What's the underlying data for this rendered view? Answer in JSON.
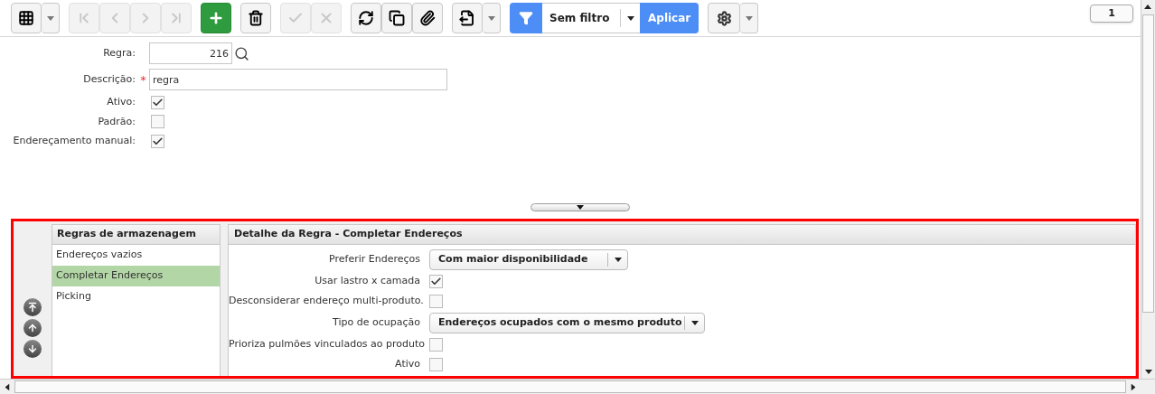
{
  "toolbar": {
    "buttons": [
      {
        "kind": "grid",
        "disabled": false
      },
      {
        "kind": "dropdown",
        "disabled": false
      },
      {
        "kind": "first",
        "disabled": true
      },
      {
        "kind": "previous",
        "disabled": true
      },
      {
        "kind": "next",
        "disabled": true
      },
      {
        "kind": "last",
        "disabled": true
      },
      {
        "kind": "add",
        "disabled": false
      },
      {
        "kind": "delete",
        "disabled": false
      },
      {
        "kind": "confirm",
        "disabled": true
      },
      {
        "kind": "cancel",
        "disabled": true
      },
      {
        "kind": "refresh",
        "disabled": false
      },
      {
        "kind": "copy",
        "disabled": false
      },
      {
        "kind": "attach",
        "disabled": false
      },
      {
        "kind": "export",
        "disabled": false
      },
      {
        "kind": "dropdown",
        "disabled": false
      }
    ],
    "filter": {
      "value": "Sem filtro",
      "apply_button": "Aplicar"
    },
    "page_badge": "1"
  },
  "form": {
    "fields": [
      {
        "kind": "number",
        "label": "Regra:",
        "value": "216"
      },
      {
        "kind": "text",
        "label": "Descrição:",
        "value": "regra",
        "required_mark": "*"
      },
      {
        "kind": "checkbox",
        "label": "Ativo:",
        "checked": true
      },
      {
        "kind": "checkbox",
        "label": "Padrão:",
        "checked": false
      },
      {
        "kind": "checkbox",
        "label": "Endereçamento manual:",
        "checked": true
      }
    ]
  },
  "rules_list": {
    "header": "Regras de armazenagem",
    "items": [
      {
        "label": "Endereços vazios",
        "selected": false
      },
      {
        "label": "Completar Endereços",
        "selected": true
      },
      {
        "label": "Picking",
        "selected": false
      }
    ]
  },
  "detail": {
    "title": "Detalhe da Regra - Completar Endereços",
    "fields": [
      {
        "kind": "select",
        "label": "Preferir Endereços",
        "value": "Com maior disponibilidade"
      },
      {
        "kind": "checkbox",
        "label": "Usar lastro x camada",
        "checked": true
      },
      {
        "kind": "checkbox",
        "label": "Desconsiderar endereço multi-produto.",
        "checked": false
      },
      {
        "kind": "select",
        "label": "Tipo de ocupação",
        "value": "Endereços ocupados com o mesmo produto"
      },
      {
        "kind": "checkbox",
        "label": "Prioriza pulmões vinculados ao produto",
        "checked": false
      },
      {
        "kind": "checkbox",
        "label": "Ativo",
        "checked": false
      }
    ]
  }
}
